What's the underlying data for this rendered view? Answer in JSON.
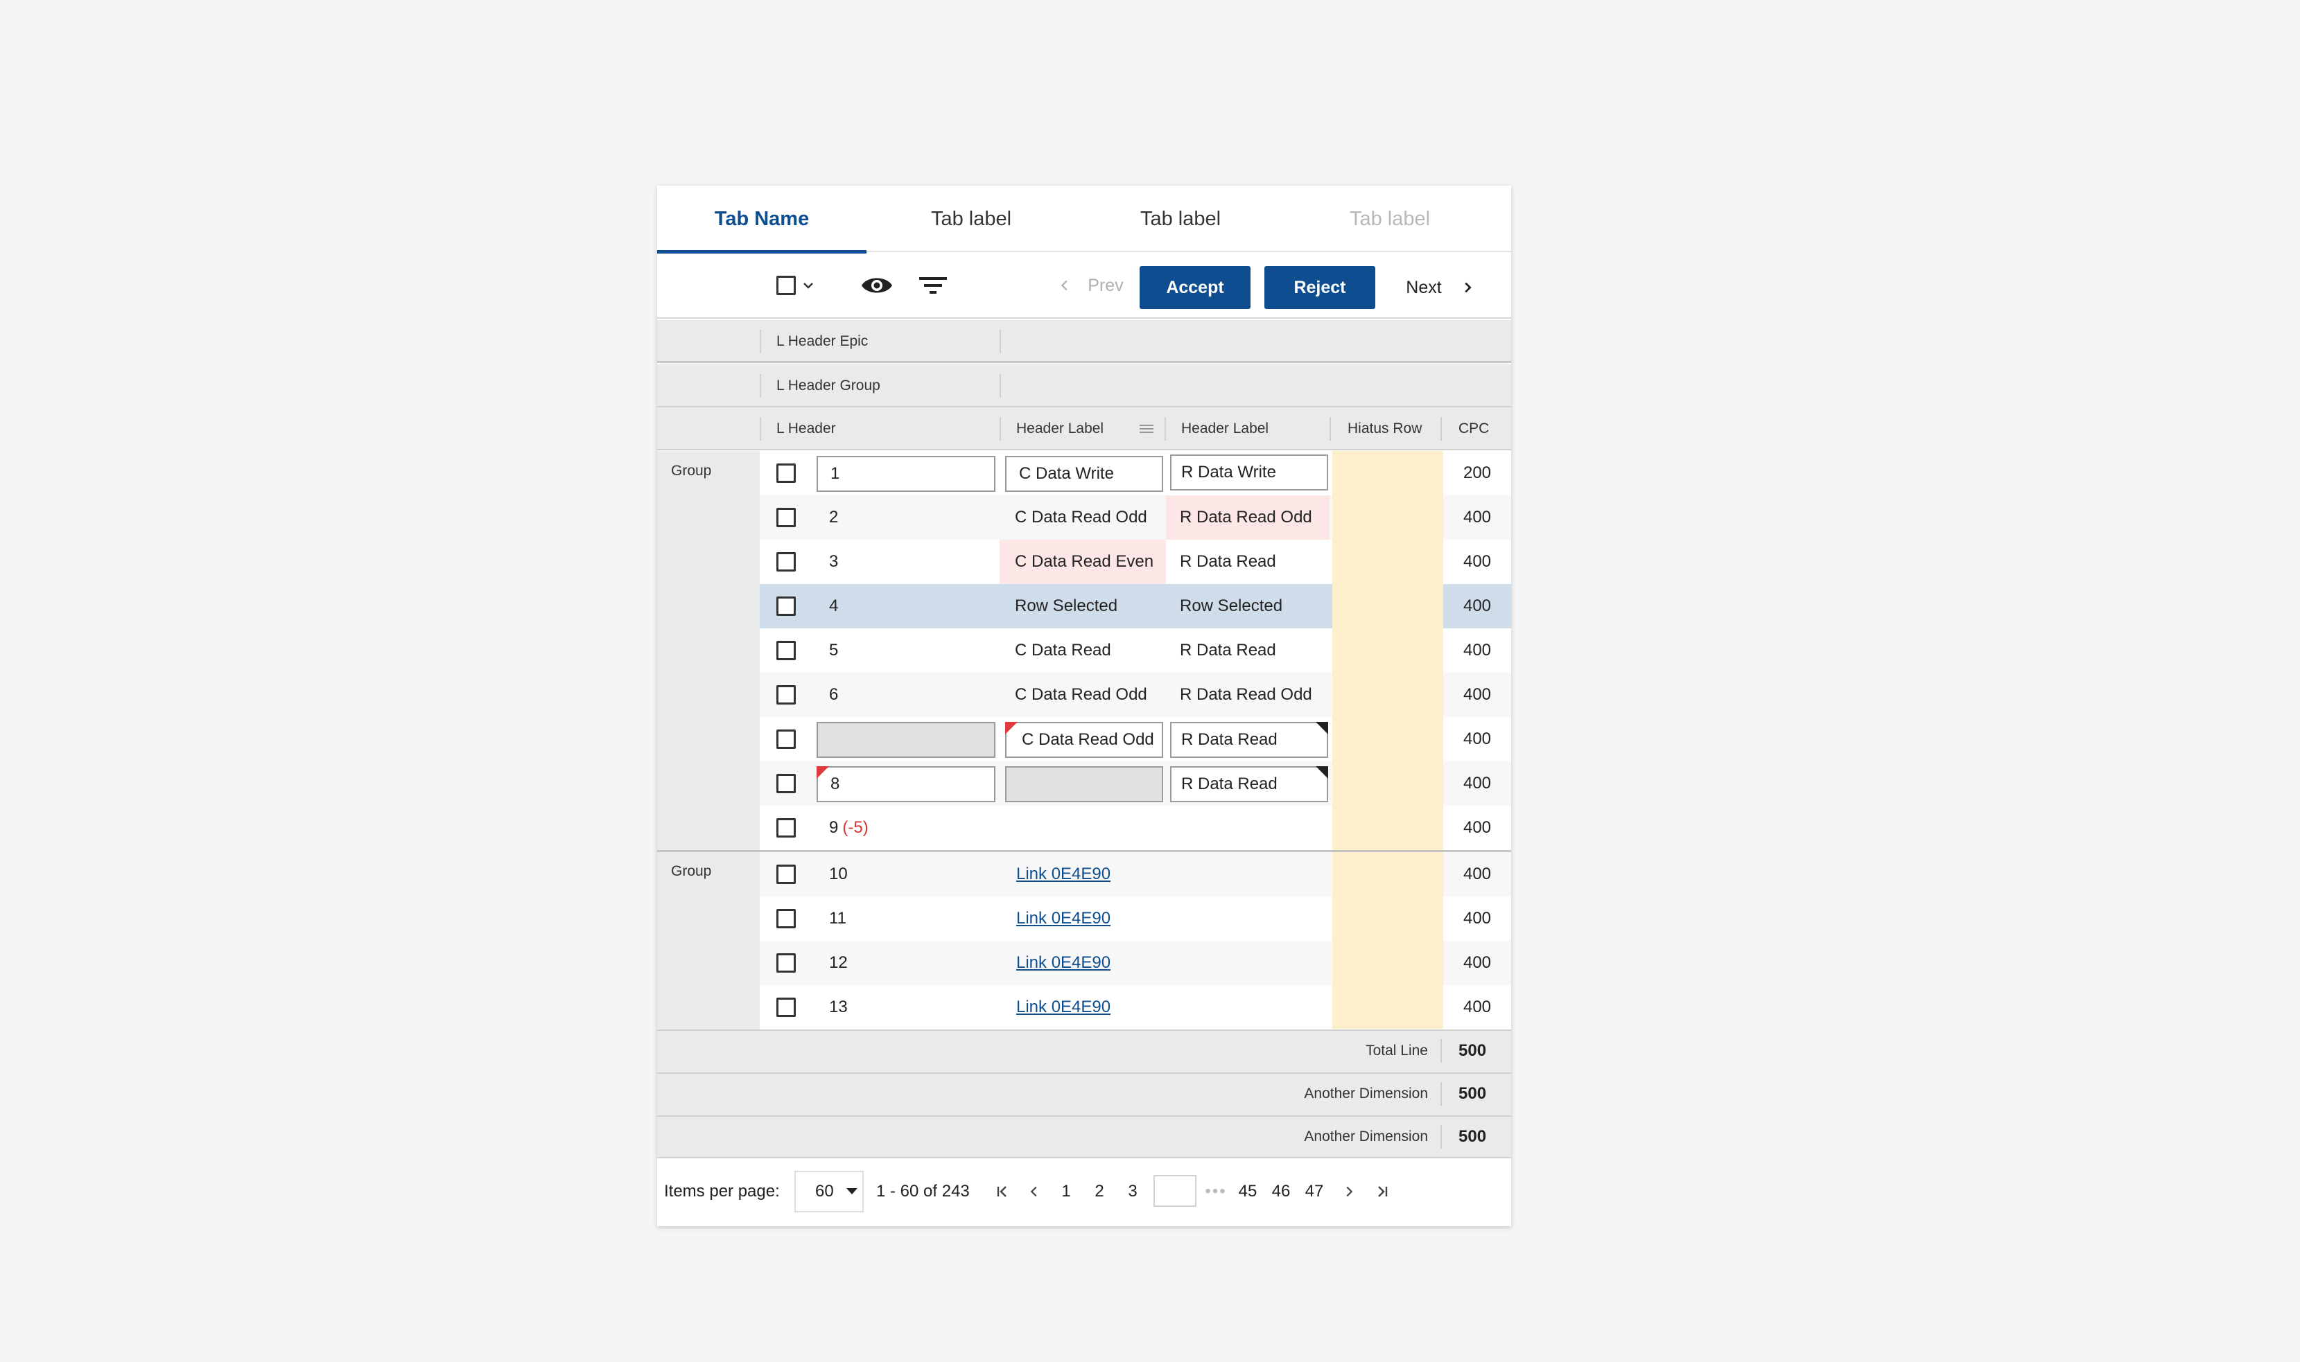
{
  "tabs": [
    {
      "label": "Tab Name",
      "state": "active"
    },
    {
      "label": "Tab label",
      "state": "normal"
    },
    {
      "label": "Tab label",
      "state": "normal"
    },
    {
      "label": "Tab label",
      "state": "disabled"
    }
  ],
  "toolbar": {
    "prev_label": "Prev",
    "accept_label": "Accept",
    "reject_label": "Reject",
    "next_label": "Next"
  },
  "headers": {
    "epic": "L Header Epic",
    "group": "L Header Group",
    "columns": [
      "L Header",
      "Header Label",
      "Header Label",
      "Hiatus Row",
      "CPC"
    ]
  },
  "groups": [
    {
      "label": "Group",
      "rows": [
        {
          "num": "1",
          "c": "C Data Write",
          "r": "R Data Write",
          "cpc": "200"
        },
        {
          "num": "2",
          "c": "C Data Read Odd",
          "r": "R Data Read Odd",
          "cpc": "400"
        },
        {
          "num": "3",
          "c": "C Data Read Even",
          "r": "R Data Read",
          "cpc": "400"
        },
        {
          "num": "4",
          "c": "Row Selected",
          "r": "Row Selected",
          "cpc": "400"
        },
        {
          "num": "5",
          "c": "C Data Read",
          "r": "R Data Read",
          "cpc": "400"
        },
        {
          "num": "6",
          "c": "C Data Read Odd",
          "r": "R Data Read Odd",
          "cpc": "400"
        },
        {
          "num": "",
          "c": "C Data Read Odd",
          "r": "R Data Read",
          "cpc": "400"
        },
        {
          "num": "8",
          "c": "",
          "r": "R Data Read",
          "cpc": "400"
        },
        {
          "num": "9",
          "delta": "(-5)",
          "c": "",
          "r": "",
          "cpc": "400"
        }
      ]
    },
    {
      "label": "Group",
      "rows": [
        {
          "num": "10",
          "link": "Link 0E4E90",
          "cpc": "400"
        },
        {
          "num": "11",
          "link": "Link 0E4E90",
          "cpc": "400"
        },
        {
          "num": "12",
          "link": "Link 0E4E90",
          "cpc": "400"
        },
        {
          "num": "13",
          "link": "Link 0E4E90",
          "cpc": "400"
        }
      ]
    }
  ],
  "totals": [
    {
      "label": "Total Line",
      "value": "500"
    },
    {
      "label": "Another Dimension",
      "value": "500"
    },
    {
      "label": "Another Dimension",
      "value": "500"
    }
  ],
  "pagination": {
    "items_per_page_label": "Items per page:",
    "items_per_page_value": "60",
    "range": "1 - 60 of 243",
    "pages_start": [
      "1",
      "2",
      "3"
    ],
    "pages_end": [
      "45",
      "46",
      "47"
    ],
    "jump_value": ""
  },
  "colors": {
    "accent": "#0e4e90",
    "selected_row": "#cfdcea",
    "error_cell": "#fde6e6",
    "hiatus_column": "#fcefc9",
    "header_band": "#eaeaea",
    "delta_negative": "#d9362f"
  },
  "icons": {
    "select_all": "checkbox-icon",
    "select_dropdown": "chevron-down-icon",
    "view": "eye-icon",
    "filter": "filter-icon",
    "prev": "chevron-left-icon",
    "next": "chevron-right-icon",
    "column_menu": "drag-handle-icon"
  }
}
